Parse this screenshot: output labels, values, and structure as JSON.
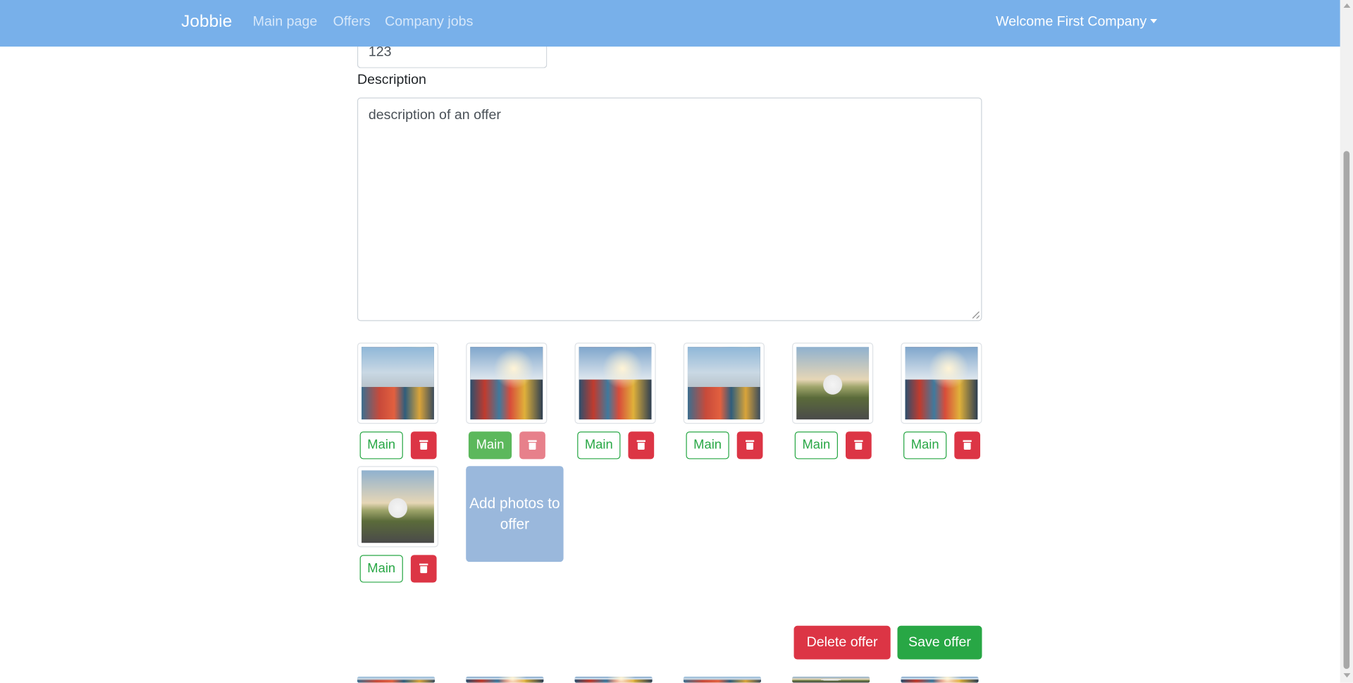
{
  "navbar": {
    "brand": "Jobbie",
    "links": [
      "Main page",
      "Offers",
      "Company jobs"
    ],
    "welcome": "Welcome First Company"
  },
  "form": {
    "top_input_value": "123",
    "description_label": "Description",
    "description_value": "description of an offer"
  },
  "photos": [
    {
      "scene": "port",
      "main_label": "Main",
      "is_main": false
    },
    {
      "scene": "port",
      "main_label": "Main",
      "is_main": true
    },
    {
      "scene": "port",
      "main_label": "Main",
      "is_main": false
    },
    {
      "scene": "port",
      "main_label": "Main",
      "is_main": false
    },
    {
      "scene": "truck",
      "main_label": "Main",
      "is_main": false
    },
    {
      "scene": "port",
      "main_label": "Main",
      "is_main": false
    },
    {
      "scene": "truck",
      "main_label": "Main",
      "is_main": false
    }
  ],
  "add_photos_label": "Add photos to offer",
  "actions": {
    "delete": "Delete offer",
    "save": "Save offer"
  },
  "colors": {
    "navbar": "#78b0ea",
    "success": "#28a745",
    "danger": "#dc3545",
    "add_tile": "#9ab8dc"
  }
}
